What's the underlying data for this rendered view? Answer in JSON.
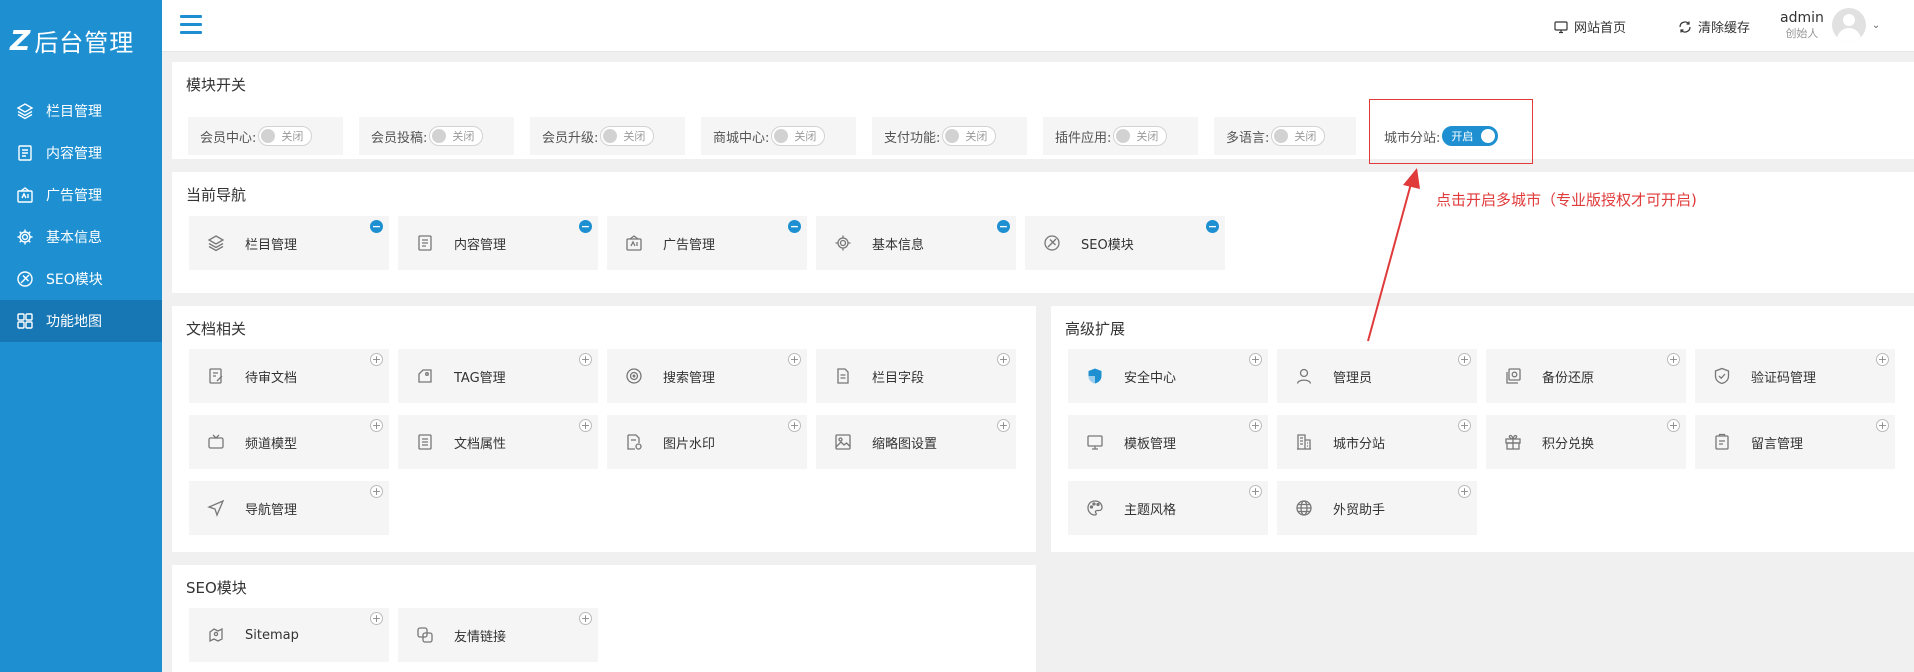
{
  "colors": {
    "primary": "#1e90d2",
    "sidebar_active": "#1776b4",
    "annotation": "#e03a3a"
  },
  "logo": {
    "mark": "Z",
    "text": "后台管理"
  },
  "sidebar": {
    "items": [
      {
        "label": "栏目管理",
        "icon": "layers-icon"
      },
      {
        "label": "内容管理",
        "icon": "document-icon"
      },
      {
        "label": "广告管理",
        "icon": "ad-icon"
      },
      {
        "label": "基本信息",
        "icon": "gear-icon"
      },
      {
        "label": "SEO模块",
        "icon": "seo-icon"
      },
      {
        "label": "功能地图",
        "icon": "grid-icon",
        "active": true
      }
    ]
  },
  "header": {
    "site_home": "网站首页",
    "clear_cache": "清除缓存",
    "user": {
      "name": "admin",
      "role": "创始人"
    }
  },
  "modules": {
    "title": "模块开关",
    "toggles": [
      {
        "label": "会员中心:",
        "state": "关闭"
      },
      {
        "label": "会员投稿:",
        "state": "关闭"
      },
      {
        "label": "会员升级:",
        "state": "关闭"
      },
      {
        "label": "商城中心:",
        "state": "关闭"
      },
      {
        "label": "支付功能:",
        "state": "关闭"
      },
      {
        "label": "插件应用:",
        "state": "关闭"
      },
      {
        "label": "多语言:",
        "state": "关闭"
      },
      {
        "label": "城市分站:",
        "state": "开启",
        "on": true
      }
    ]
  },
  "annotation": {
    "text": "点击开启多城市（专业版授权才可开启)"
  },
  "current_nav": {
    "title": "当前导航",
    "items": [
      {
        "label": "栏目管理",
        "icon": "layers-icon"
      },
      {
        "label": "内容管理",
        "icon": "document-icon"
      },
      {
        "label": "广告管理",
        "icon": "ad-icon"
      },
      {
        "label": "基本信息",
        "icon": "gear-icon"
      },
      {
        "label": "SEO模块",
        "icon": "seo-icon"
      }
    ]
  },
  "documents": {
    "title": "文档相关",
    "items": [
      {
        "label": "待审文档",
        "icon": "review-icon"
      },
      {
        "label": "TAG管理",
        "icon": "tag-icon"
      },
      {
        "label": "搜索管理",
        "icon": "target-icon"
      },
      {
        "label": "栏目字段",
        "icon": "file-icon"
      },
      {
        "label": "频道模型",
        "icon": "tv-icon"
      },
      {
        "label": "文档属性",
        "icon": "list-icon"
      },
      {
        "label": "图片水印",
        "icon": "watermark-icon"
      },
      {
        "label": "缩略图设置",
        "icon": "image-icon"
      },
      {
        "label": "导航管理",
        "icon": "navigation-icon"
      }
    ]
  },
  "advanced": {
    "title": "高级扩展",
    "items": [
      {
        "label": "安全中心",
        "icon": "shield-icon"
      },
      {
        "label": "管理员",
        "icon": "user-icon"
      },
      {
        "label": "备份还原",
        "icon": "backup-icon"
      },
      {
        "label": "验证码管理",
        "icon": "verify-icon"
      },
      {
        "label": "模板管理",
        "icon": "monitor-icon"
      },
      {
        "label": "城市分站",
        "icon": "building-icon"
      },
      {
        "label": "积分兑换",
        "icon": "gift-icon"
      },
      {
        "label": "留言管理",
        "icon": "message-icon"
      },
      {
        "label": "主题风格",
        "icon": "palette-icon"
      },
      {
        "label": "外贸助手",
        "icon": "globe-icon"
      }
    ]
  },
  "seo": {
    "title": "SEO模块",
    "items": [
      {
        "label": "Sitemap",
        "icon": "sitemap-icon"
      },
      {
        "label": "友情链接",
        "icon": "link-icon"
      }
    ]
  }
}
